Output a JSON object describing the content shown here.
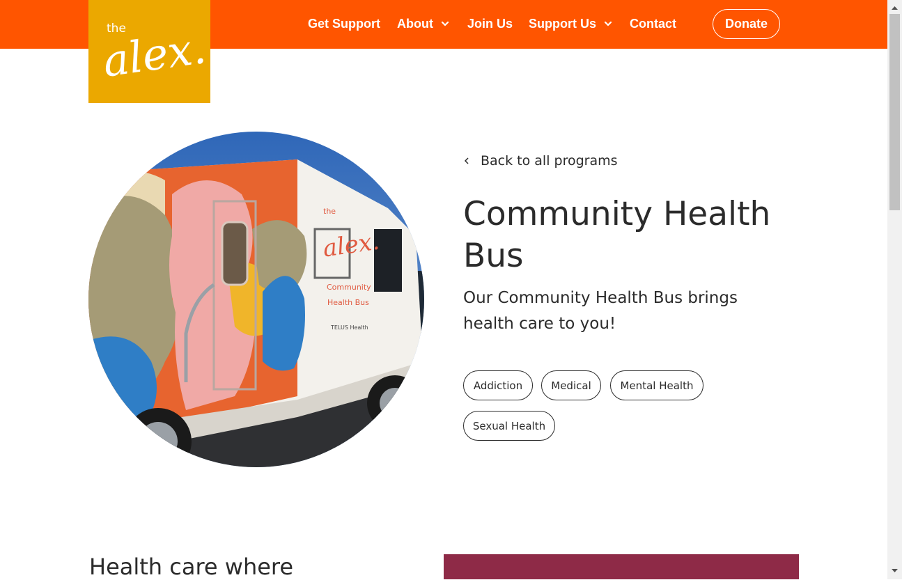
{
  "brand": {
    "logo_text_small": "the",
    "logo_text_large": "alex.",
    "color_header": "#ff5500",
    "color_logo_bg": "#eba800"
  },
  "nav": {
    "items": [
      {
        "label": "Get Support",
        "dropdown": false
      },
      {
        "label": "About",
        "dropdown": true
      },
      {
        "label": "Join Us",
        "dropdown": false
      },
      {
        "label": "Support Us",
        "dropdown": true
      },
      {
        "label": "Contact",
        "dropdown": false
      }
    ],
    "donate_label": "Donate"
  },
  "hero": {
    "back_link": "Back to all programs",
    "title": "Community Health Bus",
    "subtitle": "Our Community Health Bus brings health care to you!",
    "tags": [
      "Addiction",
      "Medical",
      "Mental Health",
      "Sexual Health"
    ],
    "image_bus_lettering": {
      "brand": "the alex.",
      "caption1": "Community",
      "caption2": "Health Bus",
      "sponsor": "TELUS Health"
    }
  },
  "section": {
    "title": "Health care where",
    "accent_color": "#8e2a47"
  }
}
